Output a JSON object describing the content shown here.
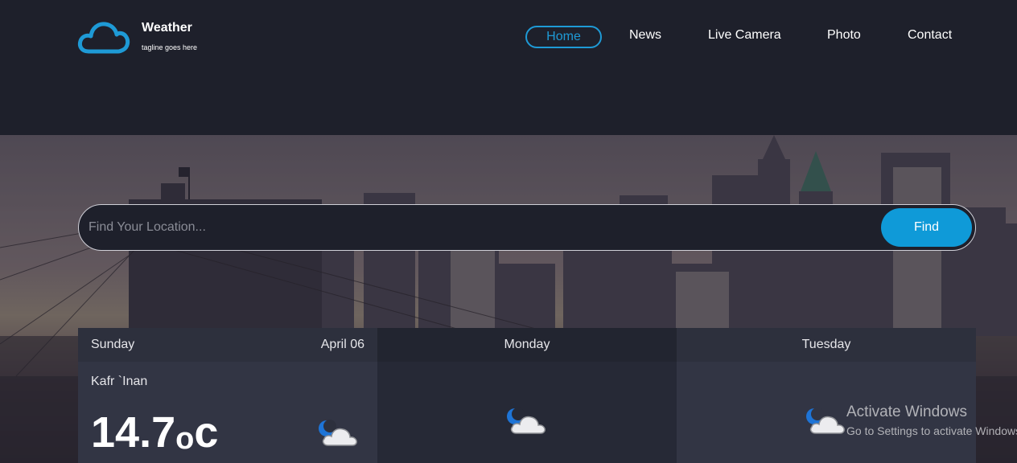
{
  "brand": {
    "title": "Weather",
    "tagline": "tagline goes here",
    "icon": "cloud-icon",
    "color": "#1e9ad6"
  },
  "nav": {
    "items": [
      {
        "label": "Home",
        "active": true
      },
      {
        "label": "News"
      },
      {
        "label": "Live Camera"
      },
      {
        "label": "Photo"
      },
      {
        "label": "Contact"
      }
    ]
  },
  "search": {
    "placeholder": "Find Your Location...",
    "value": "",
    "button_label": "Find"
  },
  "forecast": {
    "today": {
      "day": "Sunday",
      "date": "April 06",
      "location": "Kafr `Inan",
      "temp_value": "14.7",
      "temp_unit": "o",
      "temp_suffix": "c",
      "icon": "moon-cloud-icon"
    },
    "days": [
      {
        "day": "Monday",
        "icon": "moon-cloud-icon"
      },
      {
        "day": "Tuesday",
        "icon": "moon-cloud-icon"
      }
    ]
  },
  "watermark": {
    "title": "Activate Windows",
    "subtitle": "Go to Settings to activate Windows."
  },
  "colors": {
    "background": "#1e202b",
    "accent": "#0f9ad8"
  }
}
